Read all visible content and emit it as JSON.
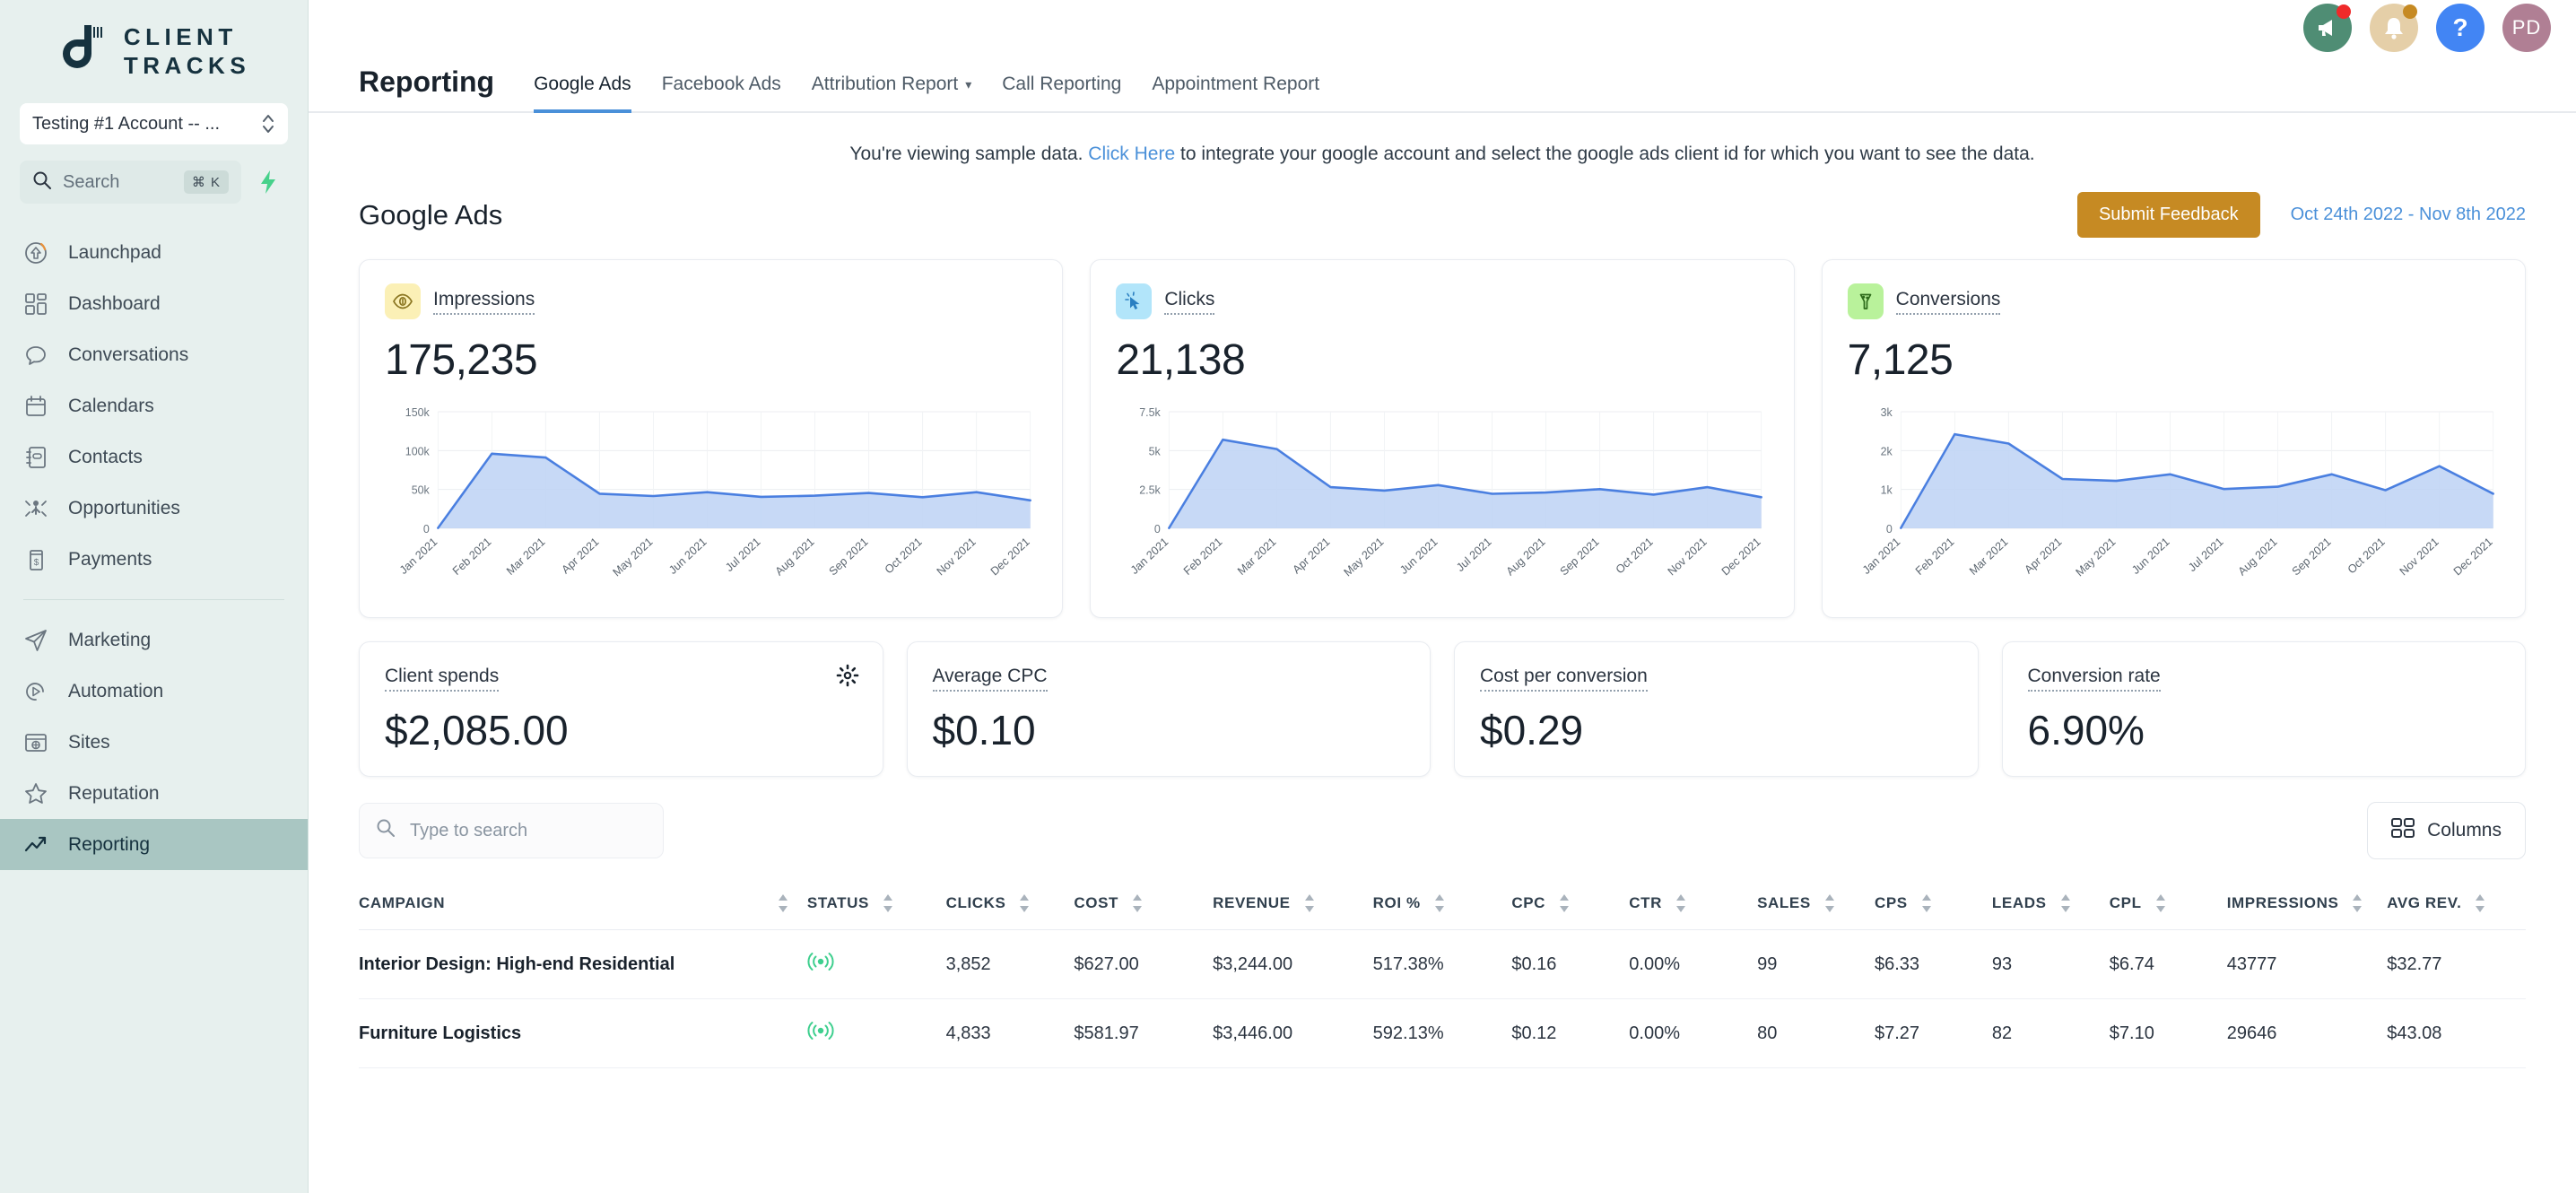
{
  "sidebar": {
    "logo_line1": "CLIENT",
    "logo_line2": "TRACKS",
    "account": "Testing #1 Account -- ...",
    "search_placeholder": "Search",
    "search_shortcut": "⌘ K",
    "items_top": [
      {
        "label": "Launchpad",
        "icon": "launchpad-icon"
      },
      {
        "label": "Dashboard",
        "icon": "dashboard-icon"
      },
      {
        "label": "Conversations",
        "icon": "conversations-icon"
      },
      {
        "label": "Calendars",
        "icon": "calendar-icon"
      },
      {
        "label": "Contacts",
        "icon": "contacts-icon"
      },
      {
        "label": "Opportunities",
        "icon": "opportunities-icon"
      },
      {
        "label": "Payments",
        "icon": "payments-icon"
      }
    ],
    "items_bottom": [
      {
        "label": "Marketing",
        "icon": "marketing-icon",
        "active": false
      },
      {
        "label": "Automation",
        "icon": "automation-icon",
        "active": false
      },
      {
        "label": "Sites",
        "icon": "sites-icon",
        "active": false
      },
      {
        "label": "Reputation",
        "icon": "reputation-icon",
        "active": false
      },
      {
        "label": "Reporting",
        "icon": "reporting-icon",
        "active": true
      }
    ]
  },
  "header": {
    "avatar_initials": "PD",
    "help_glyph": "?",
    "icons": [
      "megaphone-icon",
      "bell-icon",
      "help-icon",
      "avatar"
    ]
  },
  "nav": {
    "title": "Reporting",
    "tabs": [
      {
        "label": "Google Ads",
        "active": true,
        "caret": false
      },
      {
        "label": "Facebook Ads",
        "active": false,
        "caret": false
      },
      {
        "label": "Attribution Report",
        "active": false,
        "caret": true
      },
      {
        "label": "Call Reporting",
        "active": false,
        "caret": false
      },
      {
        "label": "Appointment Report",
        "active": false,
        "caret": false
      }
    ],
    "caret_glyph": "▾"
  },
  "banner": {
    "before": "You're viewing sample data. ",
    "link": "Click Here",
    "after": " to integrate your google account and select the google ads client id for which you want to see the data."
  },
  "page": {
    "title": "Google Ads",
    "feedback_label": "Submit Feedback",
    "date_range": "Oct 24th 2022 - Nov 8th 2022",
    "accent_feedback": "#c68a23",
    "accent_link": "#4a90d9"
  },
  "metric_cards": [
    {
      "label": "Impressions",
      "value": "175,235",
      "icon": "eye-icon",
      "chip": "chip-yellow"
    },
    {
      "label": "Clicks",
      "value": "21,138",
      "icon": "cursor-click-icon",
      "chip": "chip-blue"
    },
    {
      "label": "Conversions",
      "value": "7,125",
      "icon": "funnel-icon",
      "chip": "chip-green"
    }
  ],
  "small_cards": [
    {
      "label": "Client spends",
      "value": "$2,085.00",
      "gear": true
    },
    {
      "label": "Average CPC",
      "value": "$0.10",
      "gear": false
    },
    {
      "label": "Cost per conversion",
      "value": "$0.29",
      "gear": false
    },
    {
      "label": "Conversion rate",
      "value": "6.90%",
      "gear": false
    }
  ],
  "table_toolbar": {
    "search_placeholder": "Type to search",
    "columns_label": "Columns"
  },
  "table": {
    "columns": [
      {
        "label": "CAMPAIGN",
        "sortable": true
      },
      {
        "label": "STATUS",
        "sortable": true
      },
      {
        "label": "CLICKS",
        "sortable": true
      },
      {
        "label": "COST",
        "sortable": true
      },
      {
        "label": "REVENUE",
        "sortable": true
      },
      {
        "label": "ROI %",
        "sortable": true
      },
      {
        "label": "CPC",
        "sortable": true
      },
      {
        "label": "CTR",
        "sortable": true
      },
      {
        "label": "SALES",
        "sortable": true
      },
      {
        "label": "CPS",
        "sortable": true
      },
      {
        "label": "LEADS",
        "sortable": true
      },
      {
        "label": "CPL",
        "sortable": true
      },
      {
        "label": "IMPRESSIONS",
        "sortable": true
      },
      {
        "label": "AVG REV.",
        "sortable": true
      }
    ],
    "rows": [
      {
        "campaign": "Interior Design: High-end Residential",
        "status": "active",
        "clicks": "3,852",
        "cost": "$627.00",
        "revenue": "$3,244.00",
        "roi": "517.38%",
        "cpc": "$0.16",
        "ctr": "0.00%",
        "sales": "99",
        "cps": "$6.33",
        "leads": "93",
        "cpl": "$6.74",
        "impressions": "43777",
        "avg_rev": "$32.77"
      },
      {
        "campaign": "Furniture Logistics",
        "status": "active",
        "clicks": "4,833",
        "cost": "$581.97",
        "revenue": "$3,446.00",
        "roi": "592.13%",
        "cpc": "$0.12",
        "ctr": "0.00%",
        "sales": "80",
        "cps": "$7.27",
        "leads": "82",
        "cpl": "$7.10",
        "impressions": "29646",
        "avg_rev": "$43.08"
      }
    ]
  },
  "chart_data": [
    {
      "type": "area",
      "title": "Impressions",
      "x": [
        "Jan 2021",
        "Feb 2021",
        "Mar 2021",
        "Apr 2021",
        "May 2021",
        "Jun 2021",
        "Jul 2021",
        "Aug 2021",
        "Sep 2021",
        "Oct 2021",
        "Nov 2021",
        "Dec 2021"
      ],
      "values": [
        500,
        96000,
        91000,
        44500,
        41500,
        46500,
        40500,
        42000,
        45500,
        40000,
        46500,
        36000
      ],
      "ylim": [
        0,
        150000
      ],
      "yticks": [
        0,
        50000,
        100000,
        150000
      ],
      "ytick_labels": [
        "0",
        "50k",
        "100k",
        "150k"
      ],
      "xlabel": "",
      "ylabel": "",
      "grid": true,
      "legend": "none",
      "line_color": "#4a7fe0",
      "fill_color": "#bdd2f5"
    },
    {
      "type": "area",
      "title": "Clicks",
      "x": [
        "Jan 2021",
        "Feb 2021",
        "Mar 2021",
        "Apr 2021",
        "May 2021",
        "Jun 2021",
        "Jul 2021",
        "Aug 2021",
        "Sep 2021",
        "Oct 2021",
        "Nov 2021",
        "Dec 2021"
      ],
      "values": [
        20,
        5700,
        5100,
        2650,
        2430,
        2780,
        2220,
        2300,
        2520,
        2170,
        2650,
        2000
      ],
      "ylim": [
        0,
        7500
      ],
      "yticks": [
        0,
        2500,
        5000,
        7500
      ],
      "ytick_labels": [
        "0",
        "2.5k",
        "5k",
        "7.5k"
      ],
      "xlabel": "",
      "ylabel": "",
      "grid": true,
      "legend": "none",
      "line_color": "#4a7fe0",
      "fill_color": "#bdd2f5"
    },
    {
      "type": "area",
      "title": "Conversions",
      "x": [
        "Jan 2021",
        "Feb 2021",
        "Mar 2021",
        "Apr 2021",
        "May 2021",
        "Jun 2021",
        "Jul 2021",
        "Aug 2021",
        "Sep 2021",
        "Oct 2021",
        "Nov 2021",
        "Dec 2021"
      ],
      "values": [
        10,
        2420,
        2180,
        1270,
        1220,
        1390,
        1010,
        1070,
        1390,
        980,
        1600,
        890
      ],
      "ylim": [
        0,
        3000
      ],
      "yticks": [
        0,
        1000,
        2000,
        3000
      ],
      "ytick_labels": [
        "0",
        "1k",
        "2k",
        "3k"
      ],
      "xlabel": "",
      "ylabel": "",
      "grid": true,
      "legend": "none",
      "line_color": "#4a7fe0",
      "fill_color": "#bdd2f5"
    }
  ]
}
